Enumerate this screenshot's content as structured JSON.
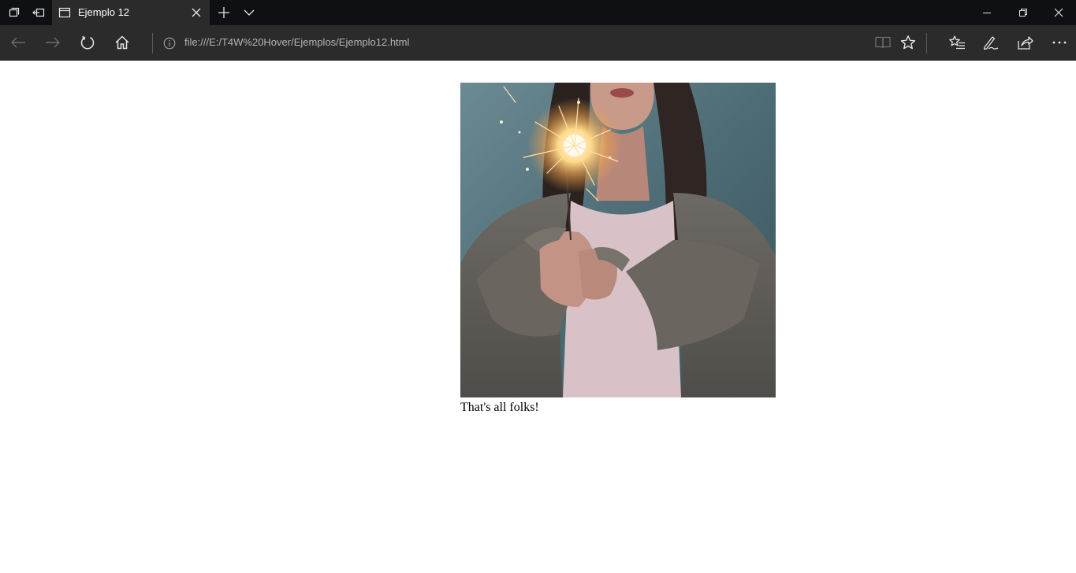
{
  "browser": {
    "tab": {
      "title": "Ejemplo 12"
    },
    "address_bar": {
      "url": "file:///E:/T4W%20Hover/Ejemplos/Ejemplo12.html"
    }
  },
  "page": {
    "caption": "That's all folks!"
  },
  "colors": {
    "titlebar_bg": "#0f1014",
    "navbar_bg": "#2b2b2b",
    "page_bg": "#ffffff",
    "icon": "#e6e6e6",
    "icon_disabled": "#6e6e6e"
  }
}
